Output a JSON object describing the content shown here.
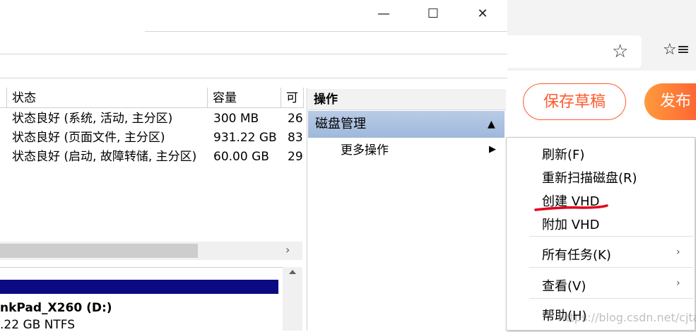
{
  "window": {
    "controls": {
      "minimize": "—",
      "maximize": "☐",
      "close": "✕"
    }
  },
  "volume_table": {
    "columns": [
      "状态",
      "容量",
      "可"
    ],
    "rows": [
      {
        "status": "状态良好 (系统, 活动, 主分区)",
        "capacity": "300 MB",
        "free": "26"
      },
      {
        "status": "状态良好 (页面文件, 主分区)",
        "capacity": "931.22 GB",
        "free": "83"
      },
      {
        "status": "状态良好 (启动, 故障转储, 主分区)",
        "capacity": "60.00 GB",
        "free": "29"
      }
    ],
    "scroll_right": "›"
  },
  "disk": {
    "label": "nkPad_X260  (D:)",
    "sub": ".22 GB NTFS"
  },
  "actions_pane": {
    "title": "操作",
    "disk_management": "磁盘管理",
    "collapse_glyph": "▲",
    "more_actions": "更多操作",
    "more_arrow": "▶"
  },
  "browser": {
    "star_icon": "☆",
    "favorites_icon": "☆≡",
    "save_draft": "保存草稿",
    "publish": "发布"
  },
  "context_menu": {
    "items": [
      {
        "label": "刷新(F)"
      },
      {
        "label": "重新扫描磁盘(R)"
      },
      {
        "label": "创建 VHD"
      },
      {
        "label": "附加 VHD"
      },
      {
        "label": "所有任务(K)"
      },
      {
        "label": "查看(V)"
      },
      {
        "label": "帮助(H)"
      }
    ],
    "submenu_arrow": "›"
  },
  "watermark": "https://blog.csdn.net/cjtaitan",
  "colors": {
    "accent_orange": "#fc5531",
    "selection_blue": "#a9c0e0",
    "annotation_red": "#e0001b",
    "disk_bar": "#0a0a82"
  }
}
